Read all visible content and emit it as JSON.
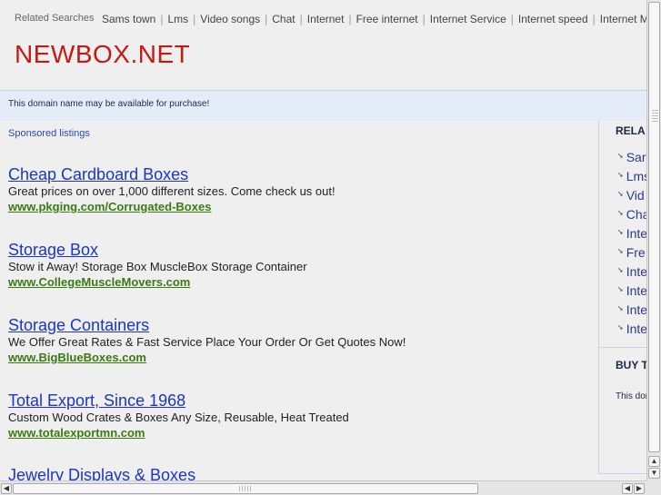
{
  "related_bar": {
    "label": "Related Searches",
    "items": [
      "Sams town",
      "Lms",
      "Video songs",
      "Chat",
      "Internet",
      "Free internet",
      "Internet Service",
      "Internet speed",
      "Internet M"
    ]
  },
  "site_title": "NEWBOX.NET",
  "notice": "This domain name may be available for purchase!",
  "sponsored_label": "Sponsored listings",
  "listings": [
    {
      "title": "Cheap Cardboard Boxes",
      "desc": "Great prices on over 1,000 different sizes. Come check us out!",
      "url": "www.pkging.com/Corrugated-Boxes"
    },
    {
      "title": "Storage Box",
      "desc": "Stow it Away! Storage Box MuscleBox Storage Container",
      "url": "www.CollegeMuscleMovers.com"
    },
    {
      "title": "Storage Containers",
      "desc": "We Offer Great Rates & Fast Service Place Your Order Or Get Quotes Now!",
      "url": "www.BigBlueBoxes.com"
    },
    {
      "title": "Total Export, Since 1968",
      "desc": "Custom Wood Crates & Boxes Any Size, Reusable, Heat Treated",
      "url": "www.totalexportmn.com"
    },
    {
      "title": "Jewelry Displays & Boxes",
      "desc": "",
      "url": ""
    }
  ],
  "right_column": {
    "title": "RELA",
    "items": [
      "Sar",
      "Lms",
      "Vid",
      "Cha",
      "Inte",
      "Fre",
      "Inte",
      "Inte",
      "Inte",
      "Inte"
    ],
    "buy_title": "BUY T",
    "buy_text": "This dor"
  },
  "scrollbars": {
    "up_arrow": "▲",
    "down_arrow": "▼",
    "left_arrow": "◀",
    "right_arrow": "▶"
  },
  "colors": {
    "site_title": "#c41a16",
    "listing_title": "#1a35c8",
    "listing_url": "#3a7a12",
    "notice_bg": "#e4ecf8"
  }
}
